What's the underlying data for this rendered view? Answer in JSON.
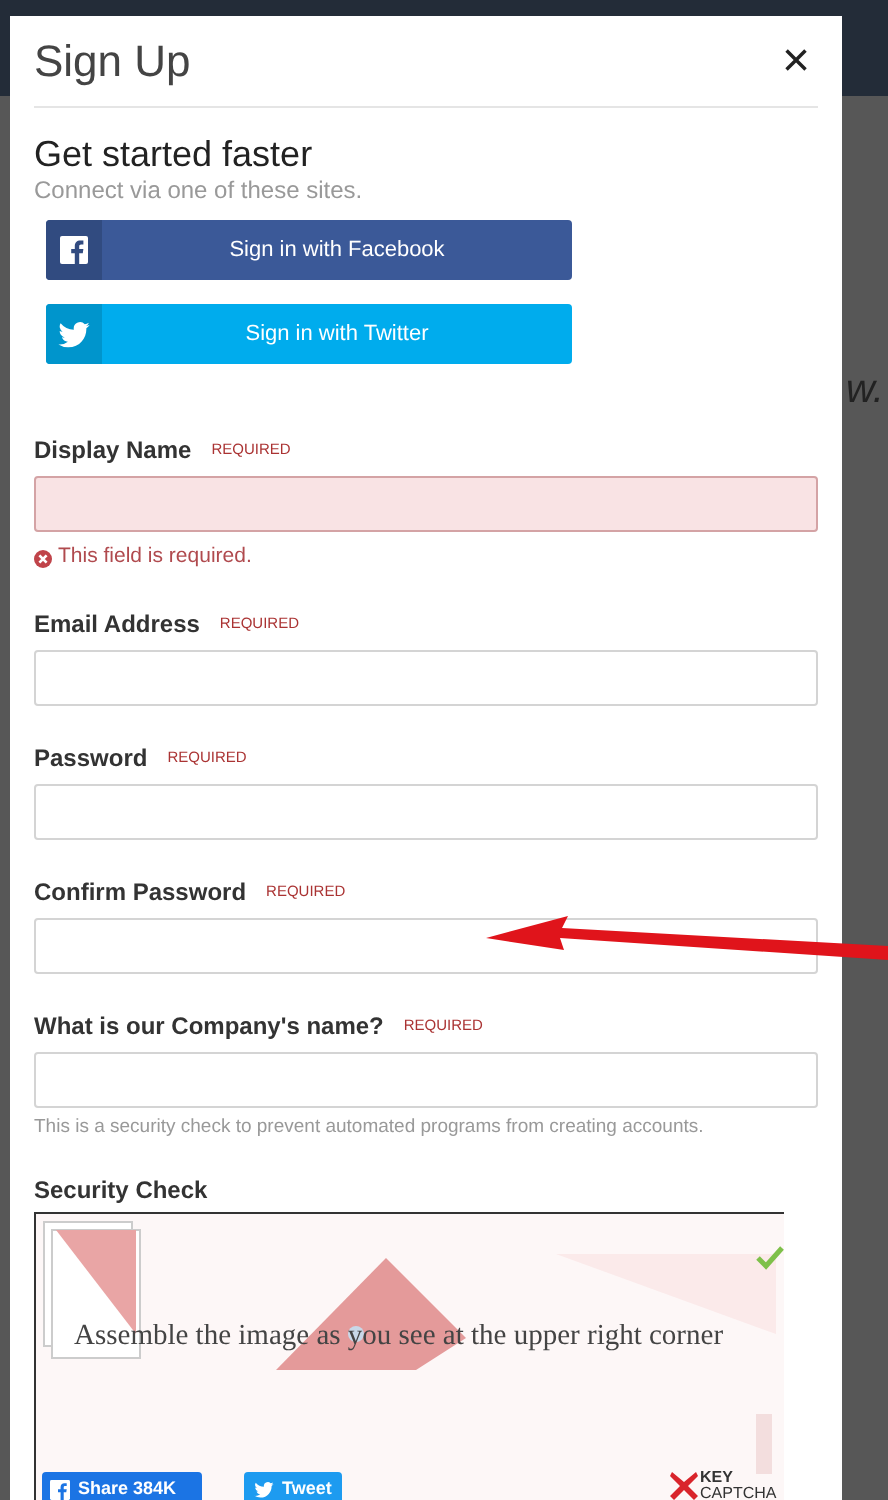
{
  "backdrop": {
    "text_fragment": "w."
  },
  "dialog": {
    "title": "Sign Up",
    "close": "×"
  },
  "social": {
    "heading": "Get started faster",
    "subheading": "Connect via one of these sites.",
    "buttons": [
      {
        "kind": "facebook",
        "label": "Sign in with Facebook"
      },
      {
        "kind": "twitter",
        "label": "Sign in with Twitter"
      }
    ]
  },
  "fields": [
    {
      "label": "Display Name",
      "tag": "REQUIRED",
      "invalid": true,
      "error": "This field is required."
    },
    {
      "label": "Email Address",
      "tag": "REQUIRED",
      "invalid": false
    },
    {
      "label": "Password",
      "tag": "REQUIRED",
      "invalid": false
    },
    {
      "label": "Confirm Password",
      "tag": "REQUIRED",
      "invalid": false
    },
    {
      "label": "What is our Company's name?",
      "tag": "REQUIRED",
      "invalid": false,
      "help": "This is a security check to prevent automated programs from creating accounts."
    }
  ],
  "security_check": {
    "label": "Security Check",
    "instruction": "Assemble the image as you see at the upper right corner",
    "share": "Share 384K",
    "tweet": "Tweet",
    "logo_top": "KEY",
    "logo_bottom": "CAPTCHA"
  }
}
